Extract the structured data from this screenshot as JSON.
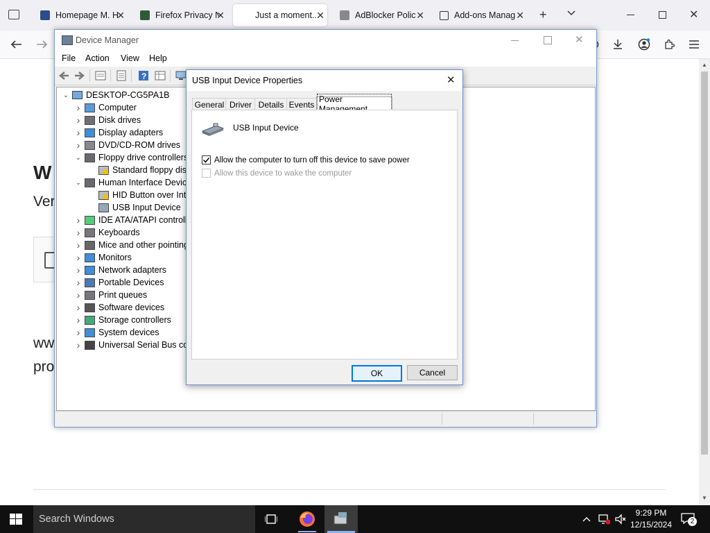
{
  "browser": {
    "tabs": [
      {
        "label": "Homepage M. H",
        "active": false
      },
      {
        "label": "Firefox Privacy N",
        "active": false
      },
      {
        "label": "Just a moment...",
        "active": true
      },
      {
        "label": "AdBlocker Polic",
        "active": false
      },
      {
        "label": "Add-ons Manag",
        "active": false
      }
    ],
    "new_tab_symbol": "+",
    "list_tabs_symbol": "⌄",
    "page_text": {
      "heading_fragment": "W",
      "sub_fragment": "Ver",
      "line1_fragment": "ww",
      "line2_fragment": "pro"
    }
  },
  "device_manager": {
    "title": "Device Manager",
    "menu": [
      "File",
      "Action",
      "View",
      "Help"
    ],
    "root": "DESKTOP-CG5PA1B",
    "tree": [
      {
        "label": "Computer",
        "level": 1,
        "expanded": false
      },
      {
        "label": "Disk drives",
        "level": 1,
        "expanded": false
      },
      {
        "label": "Display adapters",
        "level": 1,
        "expanded": false
      },
      {
        "label": "DVD/CD-ROM drives",
        "level": 1,
        "expanded": false
      },
      {
        "label": "Floppy drive controllers",
        "level": 1,
        "expanded": true
      },
      {
        "label": "Standard floppy disk",
        "level": 2,
        "warning": true
      },
      {
        "label": "Human Interface Device",
        "level": 1,
        "expanded": true
      },
      {
        "label": "HID Button over Inte",
        "level": 2,
        "warning": true
      },
      {
        "label": "USB Input Device",
        "level": 2,
        "warning": false
      },
      {
        "label": "IDE ATA/ATAPI controlle",
        "level": 1,
        "expanded": false
      },
      {
        "label": "Keyboards",
        "level": 1,
        "expanded": false
      },
      {
        "label": "Mice and other pointing",
        "level": 1,
        "expanded": false
      },
      {
        "label": "Monitors",
        "level": 1,
        "expanded": false
      },
      {
        "label": "Network adapters",
        "level": 1,
        "expanded": false
      },
      {
        "label": "Portable Devices",
        "level": 1,
        "expanded": false
      },
      {
        "label": "Print queues",
        "level": 1,
        "expanded": false
      },
      {
        "label": "Software devices",
        "level": 1,
        "expanded": false
      },
      {
        "label": "Storage controllers",
        "level": 1,
        "expanded": false
      },
      {
        "label": "System devices",
        "level": 1,
        "expanded": false
      },
      {
        "label": "Universal Serial Bus cont",
        "level": 1,
        "expanded": false
      }
    ]
  },
  "properties_dialog": {
    "title": "USB Input Device Properties",
    "tabs": [
      "General",
      "Driver",
      "Details",
      "Events",
      "Power Management"
    ],
    "active_tab": "Power Management",
    "device_name": "USB Input Device",
    "options": [
      {
        "label": "Allow the computer to turn off this device to save power",
        "checked": true,
        "enabled": true
      },
      {
        "label": "Allow this device to wake the computer",
        "checked": false,
        "enabled": false
      }
    ],
    "ok_label": "OK",
    "cancel_label": "Cancel"
  },
  "taskbar": {
    "search_placeholder": "Search Windows",
    "time": "9:29 PM",
    "date": "12/15/2024",
    "notification_count": "2"
  },
  "colors": {
    "accent": "#0078d7",
    "warning": "#f2c200",
    "firefox_orange": "#ff7139"
  }
}
